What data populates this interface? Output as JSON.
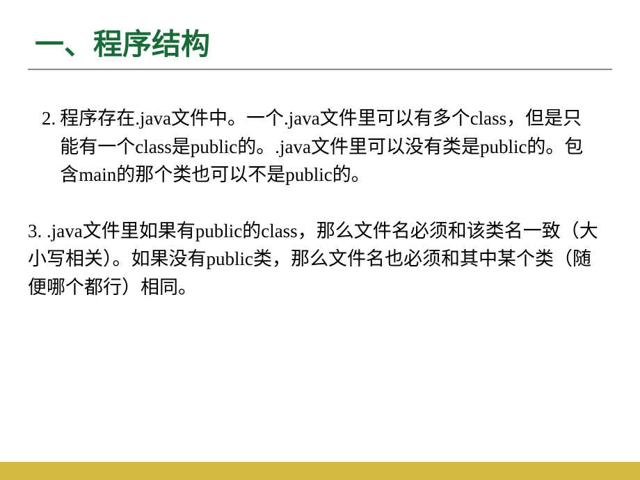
{
  "title": "一、程序结构",
  "item2": {
    "number": "2.",
    "text": "程序存在.java文件中。一个.java文件里可以有多个class，但是只能有一个class是public的。.java文件里可以没有类是public的。包含main的那个类也可以不是public的。"
  },
  "item3": {
    "text": "3. .java文件里如果有public的class，那么文件名必须和该类名一致（大小写相关）。如果没有public类，那么文件名也必须和其中某个类（随便哪个都行）相同。"
  }
}
